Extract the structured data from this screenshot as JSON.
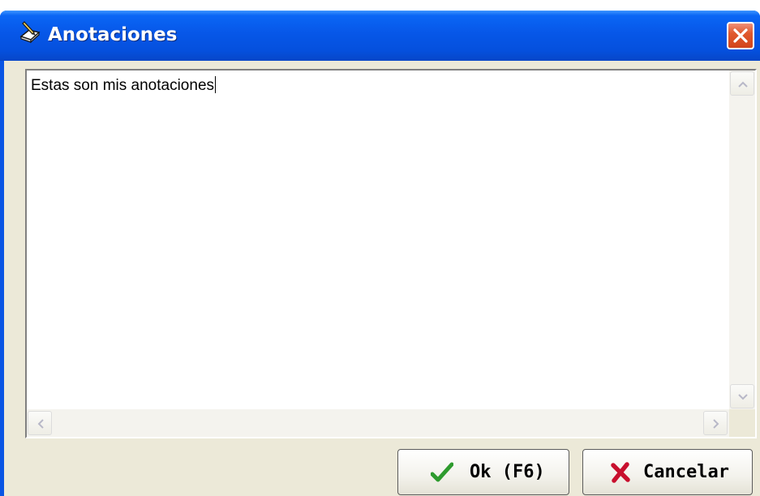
{
  "window": {
    "title": "Anotaciones",
    "icon": "pencil-note-icon",
    "close_icon": "close-icon",
    "accent_color": "#0a55e4",
    "close_color": "#d3441c"
  },
  "memo": {
    "value": "Estas son mis anotaciones",
    "vertical_scrollbar": {
      "up_icon": "chevron-up-icon",
      "down_icon": "chevron-down-icon"
    },
    "horizontal_scrollbar": {
      "left_icon": "chevron-left-icon",
      "right_icon": "chevron-right-icon"
    }
  },
  "buttons": {
    "ok": {
      "label": "Ok (F6)",
      "icon": "checkmark-icon",
      "icon_color": "#2e9b2e"
    },
    "cancel": {
      "label": "Cancelar",
      "icon": "x-mark-icon",
      "icon_color": "#c8102e"
    }
  }
}
